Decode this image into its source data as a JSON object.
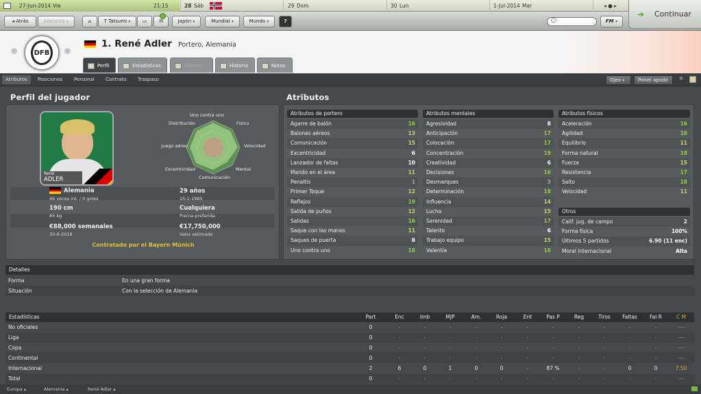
{
  "datebar": {
    "current_date": "27-Jun-2014",
    "current_day": "Vie",
    "time": "21:15",
    "d1": "28",
    "d1w": "Sáb",
    "d2": "29",
    "d2w": "Dom",
    "d3": "30",
    "d3w": "Lun",
    "d4": "1-Jul-2014",
    "d4w": "Mar"
  },
  "navbar": {
    "back": "Atrás",
    "forward": "Adelante",
    "manager": "T Tatsumi",
    "menus": [
      "Japón",
      "Mundial",
      "Mundo"
    ],
    "help": "?",
    "continue": "Continuar",
    "fm": "FM"
  },
  "player": {
    "name": "1. René Adler",
    "desc": "Portero, Alemania",
    "card_first": "René",
    "card_last": "ADLER"
  },
  "tabs": [
    "Perfil",
    "Estadísticas",
    "Informe",
    "Historia",
    "Notas"
  ],
  "subnav": {
    "items": [
      "Atributos",
      "Posiciones",
      "Personal",
      "Contrato",
      "Traspaso"
    ],
    "scout": "Ojeo",
    "bid": "Poner apodo"
  },
  "profile": {
    "title": "Perfil del jugador",
    "nation": "Alemania",
    "caps": "46 veces int. / 0 goles",
    "age": "29 años",
    "dob": "15-1-1985",
    "height": "190 cm",
    "weight": "85 kg",
    "foot": "Cualquiera",
    "foot_label": "Pierna preferida",
    "wage": "€88,000 semanales",
    "expiry": "30-6-2018",
    "value": "€17,750,000",
    "value_label": "Valor estimado",
    "club_status": "Contratado por el Bayern Múnich"
  },
  "radar": {
    "labels": [
      "Uno contra uno",
      "Físico",
      "Velocidad",
      "Mental",
      "Comunicación",
      "Excentricidad",
      "Juego aéreo",
      "Distribución"
    ]
  },
  "attrs": {
    "title": "Atributos",
    "gk_title": "Atributos de portero",
    "mental_title": "Atributos mentales",
    "phys_title": "Atributos físicos",
    "others_title": "Otros",
    "gk": [
      [
        "Agarre de balón",
        "16"
      ],
      [
        "Balones aéreos",
        "13"
      ],
      [
        "Comunicación",
        "15"
      ],
      [
        "Excentricidad",
        "6"
      ],
      [
        "Lanzador de faltas",
        "10"
      ],
      [
        "Mando en el área",
        "11"
      ],
      [
        "Penaltis",
        "1"
      ],
      [
        "Primer Toque",
        "12"
      ],
      [
        "Reflejos",
        "19"
      ],
      [
        "Salida de puños",
        "12"
      ],
      [
        "Salidas",
        "16"
      ],
      [
        "Saque con las manos",
        "11"
      ],
      [
        "Saques de puerta",
        "8"
      ],
      [
        "Uno contra uno",
        "18"
      ]
    ],
    "mental": [
      [
        "Agresividad",
        "8"
      ],
      [
        "Anticipación",
        "17"
      ],
      [
        "Colocación",
        "17"
      ],
      [
        "Concentración",
        "19"
      ],
      [
        "Creatividad",
        "6"
      ],
      [
        "Decisiones",
        "16"
      ],
      [
        "Desmarques",
        "3"
      ],
      [
        "Determinación",
        "18"
      ],
      [
        "Influencia",
        "14"
      ],
      [
        "Lucha",
        "15"
      ],
      [
        "Serenidad",
        "17"
      ],
      [
        "Talento",
        "6"
      ],
      [
        "Trabajo equipo",
        "15"
      ],
      [
        "Valentía",
        "16"
      ]
    ],
    "phys": [
      [
        "Aceleración",
        "16"
      ],
      [
        "Agilidad",
        "18"
      ],
      [
        "Equilibrio",
        "11"
      ],
      [
        "Forma natural",
        "18"
      ],
      [
        "Fuerza",
        "15"
      ],
      [
        "Resistencia",
        "17"
      ],
      [
        "Salto",
        "18"
      ],
      [
        "Velocidad",
        "11"
      ]
    ],
    "others": [
      [
        "Calif. jug. de campo",
        "2"
      ],
      [
        "Forma física",
        "100%"
      ],
      [
        "Últimos 5 partidos",
        "6.90 (11 enc)"
      ],
      [
        "Moral internacional",
        "Alta"
      ]
    ]
  },
  "details": {
    "title": "Detalles",
    "rows": [
      [
        "Forma",
        "En una gran forma"
      ],
      [
        "Situación",
        "Con la selección de Alemania"
      ]
    ]
  },
  "stats": {
    "title": "Estadísticas",
    "cols": [
      "Part",
      "Enc",
      "Imb",
      "MJP",
      "Am.",
      "Roja",
      "Ent",
      "Pas P",
      "Reg",
      "Tiros",
      "Faltas",
      "Fal R",
      "C M"
    ],
    "rows": [
      [
        "No oficiales",
        "0",
        "-",
        "-",
        "-",
        "-",
        "-",
        "-",
        "-",
        "-",
        "-",
        "-",
        "-",
        "----"
      ],
      [
        "Liga",
        "0",
        "-",
        "-",
        "-",
        "-",
        "-",
        "-",
        "-",
        "-",
        "-",
        "-",
        "-",
        "----"
      ],
      [
        "Copa",
        "0",
        "-",
        "-",
        "-",
        "-",
        "-",
        "-",
        "-",
        "-",
        "-",
        "-",
        "-",
        "----"
      ],
      [
        "Continental",
        "0",
        "-",
        "-",
        "-",
        "-",
        "-",
        "-",
        "-",
        "-",
        "-",
        "-",
        "-",
        "----"
      ],
      [
        "Internacional",
        "2",
        "6",
        "0",
        "1",
        "0",
        "0",
        "-",
        "87 %",
        "-",
        "-",
        "0",
        "0",
        "7.50"
      ],
      [
        "Total",
        "0",
        "-",
        "-",
        "-",
        "-",
        "-",
        "-",
        "-",
        "-",
        "-",
        "-",
        "-",
        "----"
      ]
    ]
  },
  "footer": [
    "Europa",
    "Alemania",
    "René Adler"
  ]
}
